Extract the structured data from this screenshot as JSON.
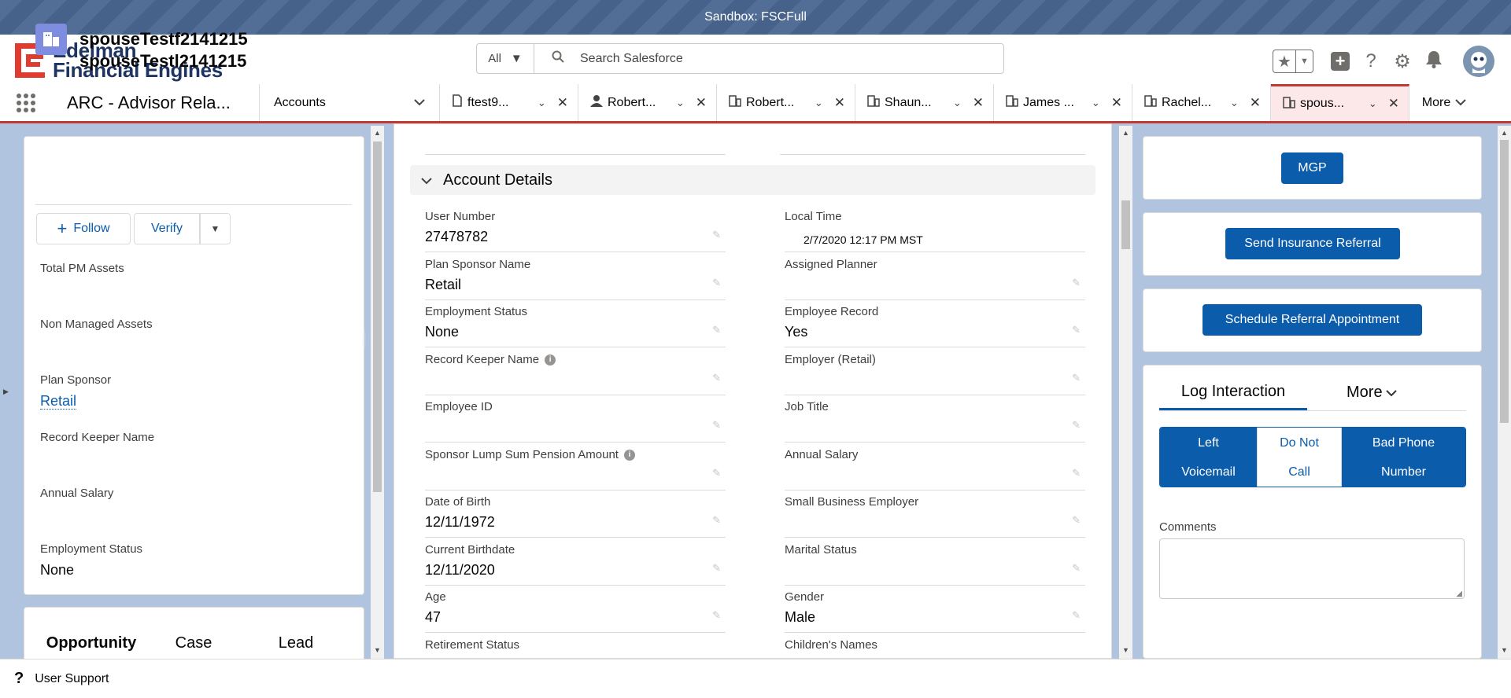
{
  "banner": {
    "text": "Sandbox: FSCFull"
  },
  "brand": {
    "line1": "Edelman",
    "line2": "Financial Engines",
    "accent": "#e03b2f",
    "navy": "#1e3462"
  },
  "search": {
    "scope": "All",
    "placeholder": "Search Salesforce"
  },
  "header_icons": [
    "star-icon",
    "add-icon",
    "help-icon",
    "setup-gear-icon",
    "notifications-bell-icon",
    "avatar"
  ],
  "nav": {
    "app_name": "ARC - Advisor Rela...",
    "object_tab": "Accounts",
    "tabs": [
      {
        "label": "ftest9...",
        "icon": "document-icon",
        "active": false
      },
      {
        "label": "Robert...",
        "icon": "person-icon",
        "active": false
      },
      {
        "label": "Robert...",
        "icon": "household-icon",
        "active": false
      },
      {
        "label": "Shaun...",
        "icon": "household-icon",
        "active": false
      },
      {
        "label": "James ...",
        "icon": "household-icon",
        "active": false
      },
      {
        "label": "Rachel...",
        "icon": "household-icon",
        "active": false
      },
      {
        "label": "spous...",
        "icon": "household-icon",
        "active": true
      }
    ],
    "more": "More"
  },
  "left_panel": {
    "name_line1": "spouseTestf2141215",
    "name_line2": "spouseTestl2141215",
    "follow": "Follow",
    "verify": "Verify",
    "fields": [
      {
        "label": "Total PM Assets",
        "value": ""
      },
      {
        "label": "Non Managed Assets",
        "value": ""
      },
      {
        "label": "Plan Sponsor",
        "value": "Retail",
        "link": true
      },
      {
        "label": "Record Keeper Name",
        "value": ""
      },
      {
        "label": "Annual Salary",
        "value": ""
      },
      {
        "label": "Employment Status",
        "value": "None"
      }
    ],
    "tabs": [
      "Opportunity",
      "Case",
      "Lead"
    ]
  },
  "middle_panel": {
    "section_title": "Account Details",
    "fields_left": [
      {
        "label": "User Number",
        "value": "27478782",
        "info": false
      },
      {
        "label": "Plan Sponsor Name",
        "value": "Retail",
        "info": false
      },
      {
        "label": "Employment Status",
        "value": "None",
        "info": false
      },
      {
        "label": "Record Keeper Name",
        "value": "",
        "info": true
      },
      {
        "label": "Employee ID",
        "value": "",
        "info": false
      },
      {
        "label": "Sponsor Lump Sum Pension Amount",
        "value": "",
        "info": true
      },
      {
        "label": "Date of Birth",
        "value": "12/11/1972",
        "info": false
      },
      {
        "label": "Current Birthdate",
        "value": "12/11/2020",
        "info": false
      },
      {
        "label": "Age",
        "value": "47",
        "info": false
      },
      {
        "label": "Retirement Status",
        "value": "",
        "info": false
      }
    ],
    "fields_right": [
      {
        "label": "Local Time",
        "value": "2/7/2020 12:17 PM MST",
        "small": true
      },
      {
        "label": "Assigned Planner",
        "value": ""
      },
      {
        "label": "Employee Record",
        "value": "Yes"
      },
      {
        "label": "Employer (Retail)",
        "value": ""
      },
      {
        "label": "Job Title",
        "value": ""
      },
      {
        "label": "Annual Salary",
        "value": ""
      },
      {
        "label": "Small Business Employer",
        "value": ""
      },
      {
        "label": "Marital Status",
        "value": ""
      },
      {
        "label": "Gender",
        "value": "Male"
      },
      {
        "label": "Children's Names",
        "value": ""
      }
    ]
  },
  "right_panel": {
    "mgp": "MGP",
    "insurance_referral": "Send Insurance Referral",
    "schedule_referral": "Schedule Referral Appointment",
    "log_tab": "Log Interaction",
    "more_tab": "More",
    "actions": [
      "Left Voicemail",
      "Do Not Call",
      "Bad Phone Number"
    ],
    "comments_label": "Comments"
  },
  "utility": {
    "label": "User Support"
  }
}
